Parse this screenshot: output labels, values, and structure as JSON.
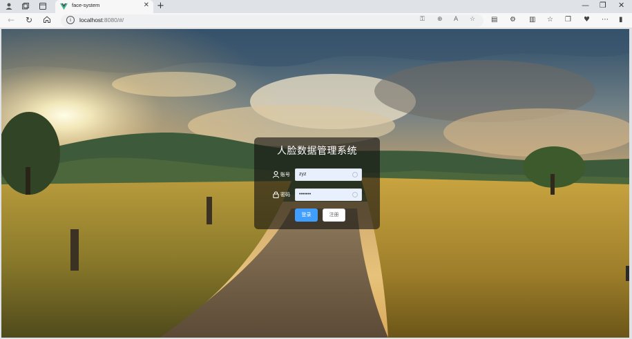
{
  "browser": {
    "tab_title": "face-system",
    "new_tab": "+",
    "url_host": "localhost",
    "url_rest": ":8080/#/",
    "window_controls": [
      "—",
      "❐",
      "✕"
    ]
  },
  "app": {
    "title": "人脸数据管理系统",
    "username_label": "账号",
    "username_value": "zyz",
    "password_label": "密码",
    "password_value": "•••••••",
    "login_button": "登录",
    "register_button": "注册"
  },
  "colors": {
    "primary": "#409eff",
    "panel": "rgba(20,18,16,0.62)"
  }
}
